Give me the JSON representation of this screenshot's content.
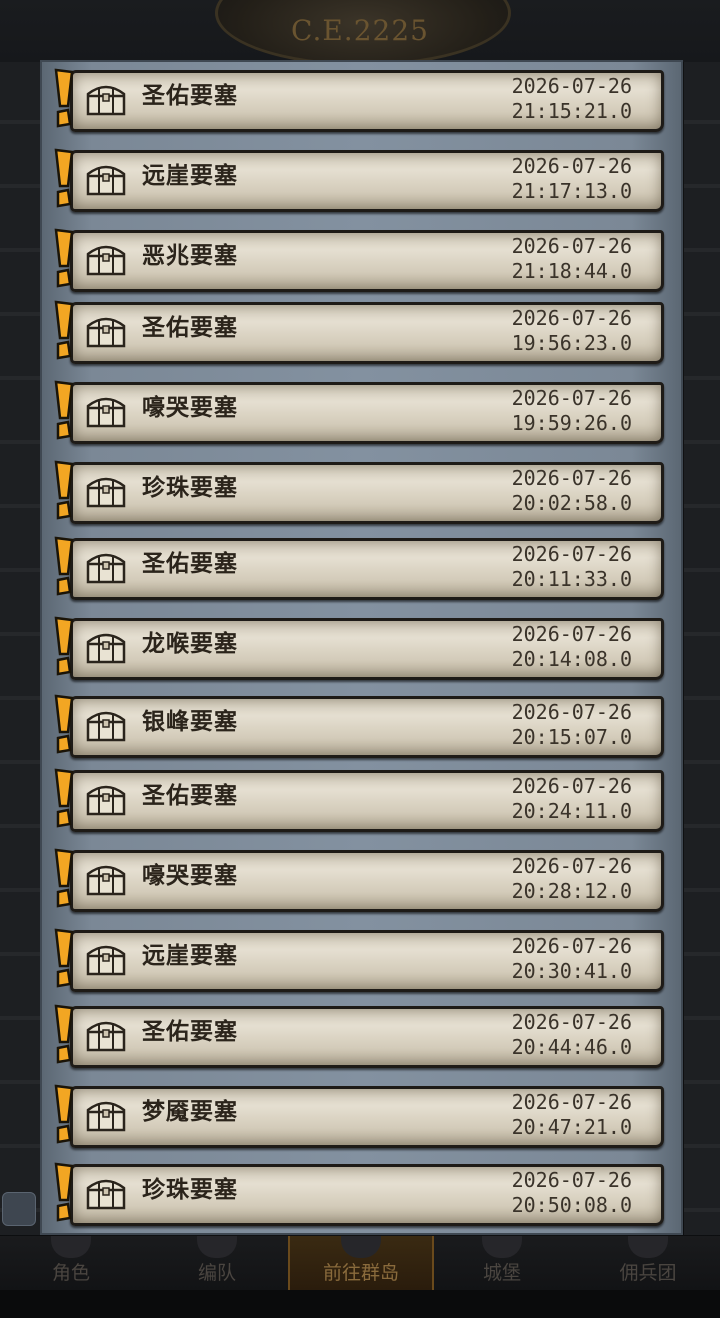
{
  "header": {
    "era_label": "C.E.2225"
  },
  "records": [
    {
      "fortress": "圣佑要塞",
      "date": "2026-07-26",
      "time": "21:15:21.0"
    },
    {
      "fortress": "远崖要塞",
      "date": "2026-07-26",
      "time": "21:17:13.0"
    },
    {
      "fortress": "恶兆要塞",
      "date": "2026-07-26",
      "time": "21:18:44.0"
    },
    {
      "fortress": "圣佑要塞",
      "date": "2026-07-26",
      "time": "19:56:23.0"
    },
    {
      "fortress": "嚎哭要塞",
      "date": "2026-07-26",
      "time": "19:59:26.0"
    },
    {
      "fortress": "珍珠要塞",
      "date": "2026-07-26",
      "time": "20:02:58.0"
    },
    {
      "fortress": "圣佑要塞",
      "date": "2026-07-26",
      "time": "20:11:33.0"
    },
    {
      "fortress": "龙喉要塞",
      "date": "2026-07-26",
      "time": "20:14:08.0"
    },
    {
      "fortress": "银峰要塞",
      "date": "2026-07-26",
      "time": "20:15:07.0"
    },
    {
      "fortress": "圣佑要塞",
      "date": "2026-07-26",
      "time": "20:24:11.0"
    },
    {
      "fortress": "嚎哭要塞",
      "date": "2026-07-26",
      "time": "20:28:12.0"
    },
    {
      "fortress": "远崖要塞",
      "date": "2026-07-26",
      "time": "20:30:41.0"
    },
    {
      "fortress": "圣佑要塞",
      "date": "2026-07-26",
      "time": "20:44:46.0"
    },
    {
      "fortress": "梦魇要塞",
      "date": "2026-07-26",
      "time": "20:47:21.0"
    },
    {
      "fortress": "珍珠要塞",
      "date": "2026-07-26",
      "time": "20:50:08.0"
    }
  ],
  "icons": {
    "alert": "exclamation-icon",
    "chest": "treasure-chest-icon"
  },
  "colors": {
    "alert": "#f2a623",
    "scroll": "#ddd6c6",
    "panel": "#8391a0",
    "nav_active": "#8a6b3c"
  },
  "bottom_nav": {
    "items": [
      {
        "label": "角色"
      },
      {
        "label": "编队"
      },
      {
        "label": "前往群岛",
        "active": true
      },
      {
        "label": "城堡"
      },
      {
        "label": "佣兵团"
      }
    ]
  }
}
